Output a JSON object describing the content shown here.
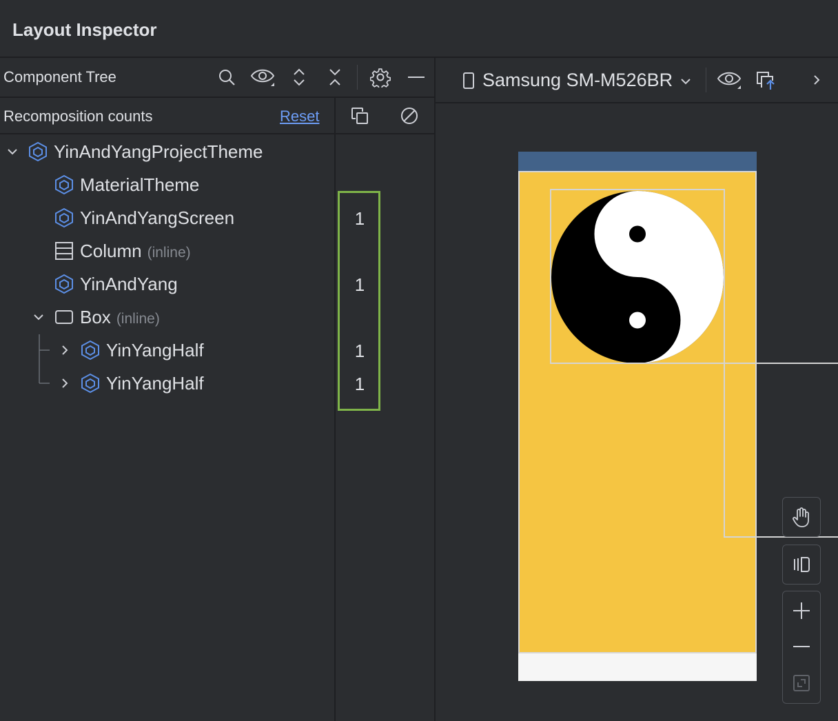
{
  "window": {
    "title": "Layout Inspector"
  },
  "component_tree": {
    "title": "Component Tree",
    "toolbar_icons": [
      "search-icon",
      "eye-icon",
      "expand-all-icon",
      "collapse-all-icon",
      "gear-icon",
      "minimize-icon"
    ],
    "recomposition": {
      "label": "Recomposition counts",
      "reset_label": "Reset"
    },
    "nodes": [
      {
        "name": "YinAndYangProjectTheme",
        "type": "composable",
        "count": ""
      },
      {
        "name": "MaterialTheme",
        "type": "composable",
        "count": ""
      },
      {
        "name": "YinAndYangScreen",
        "type": "composable",
        "count": "1"
      },
      {
        "name": "Column",
        "suffix": "(inline)",
        "type": "column",
        "count": ""
      },
      {
        "name": "YinAndYang",
        "type": "composable",
        "count": "1"
      },
      {
        "name": "Box",
        "suffix": "(inline)",
        "type": "box",
        "count": ""
      },
      {
        "name": "YinYangHalf",
        "type": "composable",
        "count": "1"
      },
      {
        "name": "YinYangHalf",
        "type": "composable",
        "count": "1"
      }
    ]
  },
  "device": {
    "name": "Samsung SM-M526BR",
    "colors": {
      "status_bar": "#426289",
      "screen_bg": "#f5c542",
      "nav_bar": "#f6f6f6"
    }
  },
  "colors": {
    "panel_bg": "#2b2d30",
    "accent_link": "#6d9df6",
    "highlight_box": "#7fb449",
    "composable_icon": "#5c8fe6"
  }
}
